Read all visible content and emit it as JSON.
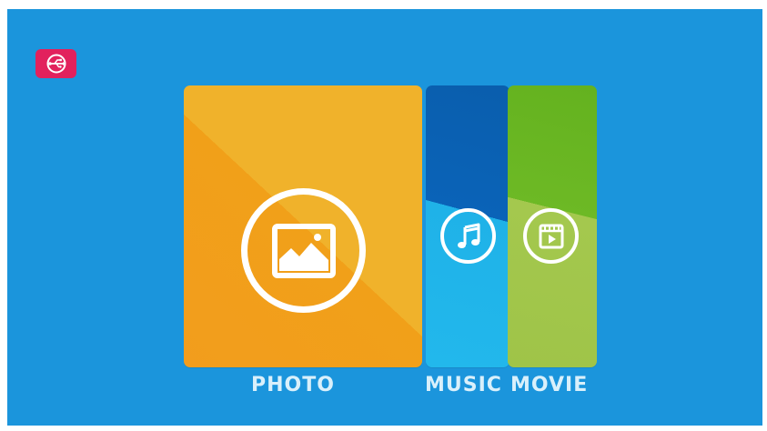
{
  "menu": {
    "items": [
      {
        "label": "PHOTO",
        "icon": "photo-icon",
        "color": "#f2a21c"
      },
      {
        "label": "MUSIC",
        "icon": "music-note-icon",
        "color": "#1fb2e8"
      },
      {
        "label": "MOVIE",
        "icon": "movie-icon",
        "color": "#8fc13e"
      }
    ]
  },
  "source_badge": {
    "icon": "usb-icon",
    "color": "#e2215d"
  },
  "theme": {
    "background": "#1b95dc",
    "label_color": "#d9f0fb"
  }
}
